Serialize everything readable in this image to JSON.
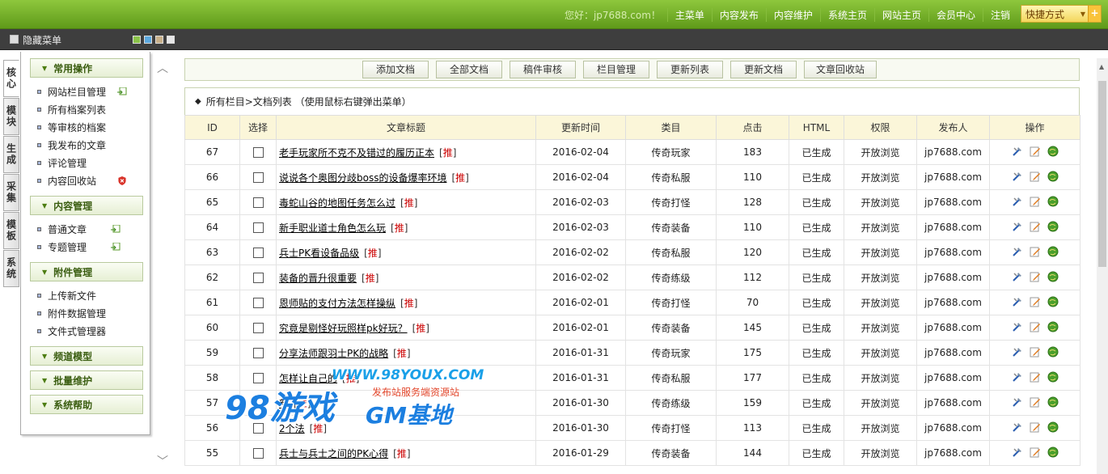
{
  "topbar": {
    "greeting": "您好：jp7688.com！",
    "nav": [
      "主菜单",
      "内容发布",
      "内容维护",
      "系统主页",
      "网站主页",
      "会员中心",
      "注销"
    ],
    "quick_label": "快捷方式",
    "quick_plus": "+"
  },
  "subbar": {
    "menu_label": "隐藏菜单",
    "swatches": [
      "#8bc34a",
      "#5da9e0",
      "#c8b08a",
      "#e6e6e6"
    ]
  },
  "left_tabs": [
    "核心",
    "模块",
    "生成",
    "采集",
    "模板",
    "系统"
  ],
  "sidebar": {
    "groups": [
      {
        "label": "常用操作",
        "items": [
          {
            "label": "网站栏目管理",
            "ext": true
          },
          {
            "label": "所有档案列表"
          },
          {
            "label": "等审核的档案"
          },
          {
            "label": "我发布的文章"
          },
          {
            "label": "评论管理"
          },
          {
            "label": "内容回收站",
            "ext": true
          }
        ]
      },
      {
        "label": "内容管理",
        "items": [
          {
            "label": "普通文章",
            "ext": true
          },
          {
            "label": "专题管理",
            "ext": true
          }
        ]
      },
      {
        "label": "附件管理",
        "items": [
          {
            "label": "上传新文件"
          },
          {
            "label": "附件数据管理"
          },
          {
            "label": "文件式管理器"
          }
        ]
      },
      {
        "label": "频道模型",
        "items": []
      },
      {
        "label": "批量维护",
        "items": []
      },
      {
        "label": "系统帮助",
        "items": []
      }
    ]
  },
  "toolbar": [
    "添加文档",
    "全部文档",
    "稿件审核",
    "栏目管理",
    "更新列表",
    "更新文档",
    "文章回收站"
  ],
  "path": "所有栏目>文档列表 （使用鼠标右键弹出菜单）",
  "table": {
    "headers": [
      "ID",
      "选择",
      "文章标题",
      "更新时间",
      "类目",
      "点击",
      "HTML",
      "权限",
      "发布人",
      "操作"
    ],
    "rec_label": "推",
    "rows": [
      {
        "id": "67",
        "title": "老手玩家所不克不及错过的履历正本",
        "date": "2016-02-04",
        "cat": "传奇玩家",
        "hits": "183",
        "html": "已生成",
        "perm": "开放浏览",
        "author": "jp7688.com"
      },
      {
        "id": "66",
        "title": "说说各个奥图分歧boss的设备爆率环境",
        "date": "2016-02-04",
        "cat": "传奇私服",
        "hits": "110",
        "html": "已生成",
        "perm": "开放浏览",
        "author": "jp7688.com"
      },
      {
        "id": "65",
        "title": "毒蛇山谷的地图任务怎么过",
        "date": "2016-02-03",
        "cat": "传奇打怪",
        "hits": "128",
        "html": "已生成",
        "perm": "开放浏览",
        "author": "jp7688.com"
      },
      {
        "id": "64",
        "title": "新手职业道士角色怎么玩",
        "date": "2016-02-03",
        "cat": "传奇装备",
        "hits": "110",
        "html": "已生成",
        "perm": "开放浏览",
        "author": "jp7688.com"
      },
      {
        "id": "63",
        "title": "兵士PK看设备品级",
        "date": "2016-02-02",
        "cat": "传奇私服",
        "hits": "120",
        "html": "已生成",
        "perm": "开放浏览",
        "author": "jp7688.com"
      },
      {
        "id": "62",
        "title": "装备的晋升很重要",
        "date": "2016-02-02",
        "cat": "传奇练级",
        "hits": "112",
        "html": "已生成",
        "perm": "开放浏览",
        "author": "jp7688.com"
      },
      {
        "id": "61",
        "title": "恩师贴的支付方法怎样操纵",
        "date": "2016-02-01",
        "cat": "传奇打怪",
        "hits": "70",
        "html": "已生成",
        "perm": "开放浏览",
        "author": "jp7688.com"
      },
      {
        "id": "60",
        "title": "究竟是剔怪好玩照样pk好玩？",
        "date": "2016-02-01",
        "cat": "传奇装备",
        "hits": "145",
        "html": "已生成",
        "perm": "开放浏览",
        "author": "jp7688.com"
      },
      {
        "id": "59",
        "title": "分享法师跟羽士PK的战略",
        "date": "2016-01-31",
        "cat": "传奇玩家",
        "hits": "175",
        "html": "已生成",
        "perm": "开放浏览",
        "author": "jp7688.com"
      },
      {
        "id": "58",
        "title": "怎样让自己的",
        "date": "2016-01-31",
        "cat": "传奇私服",
        "hits": "177",
        "html": "已生成",
        "perm": "开放浏览",
        "author": "jp7688.com"
      },
      {
        "id": "57",
        "title": "新",
        "date": "2016-01-30",
        "cat": "传奇练级",
        "hits": "159",
        "html": "已生成",
        "perm": "开放浏览",
        "author": "jp7688.com"
      },
      {
        "id": "56",
        "title": "2个法",
        "date": "2016-01-30",
        "cat": "传奇打怪",
        "hits": "113",
        "html": "已生成",
        "perm": "开放浏览",
        "author": "jp7688.com"
      },
      {
        "id": "55",
        "title": "兵士与兵士之间的PK心得",
        "date": "2016-01-29",
        "cat": "传奇装备",
        "hits": "144",
        "html": "已生成",
        "perm": "开放浏览",
        "author": "jp7688.com"
      }
    ]
  },
  "watermark": {
    "url": "WWW.98YOUX.COM",
    "big": "98游戏",
    "gm": "GM基地",
    "sub": "发布站服务端资源站"
  }
}
